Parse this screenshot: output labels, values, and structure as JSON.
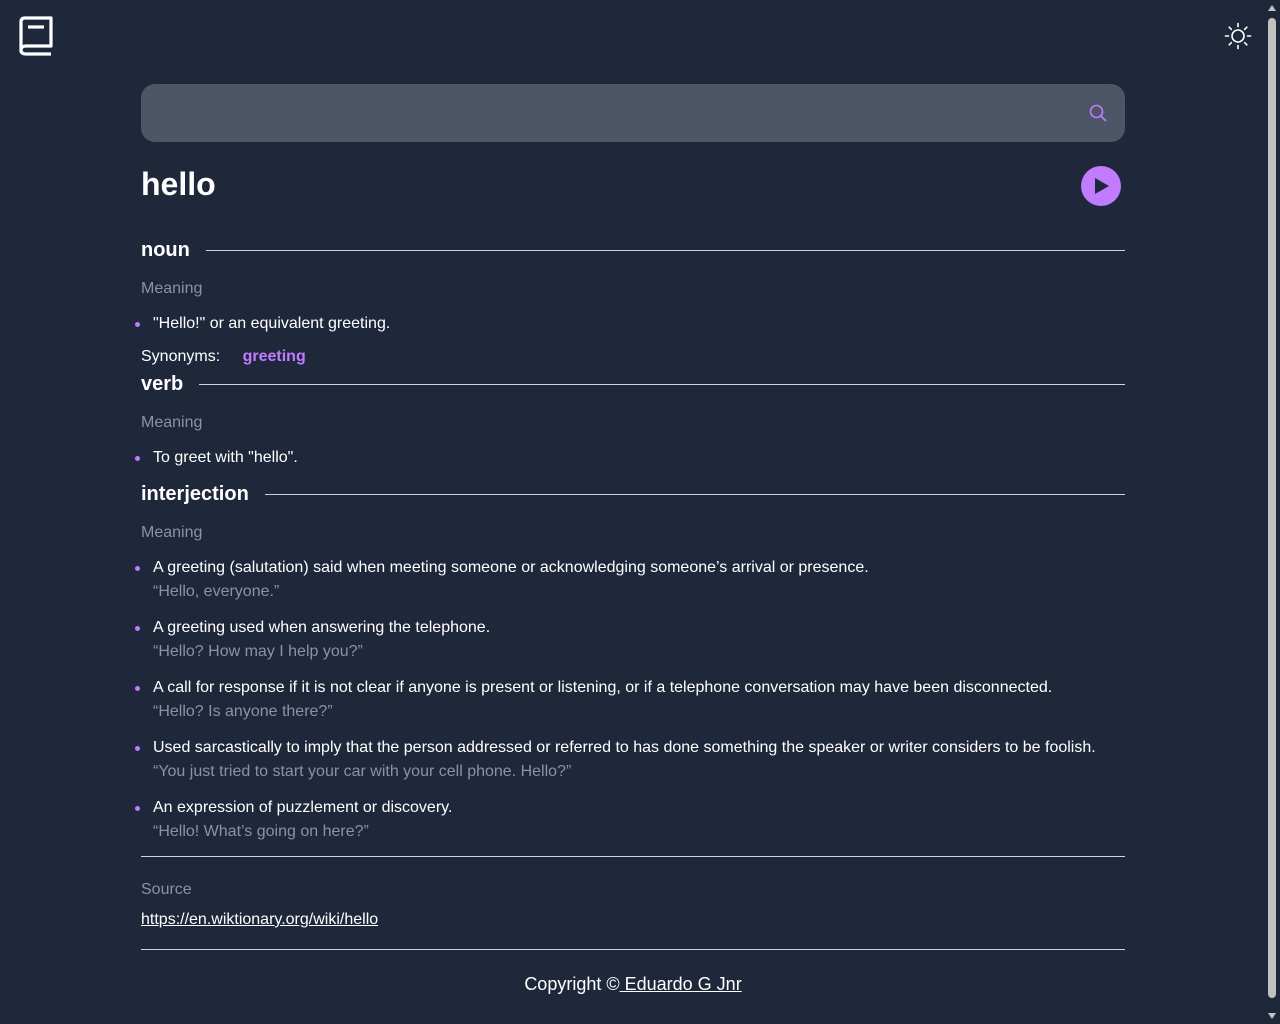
{
  "header": {
    "logo_icon": "book-icon",
    "theme_icon": "sun-icon"
  },
  "search": {
    "value": "",
    "placeholder": "",
    "icon": "search-icon"
  },
  "entry": {
    "word": "hello",
    "play_icon": "play-icon",
    "accent_color": "#c07bff"
  },
  "meanings": [
    {
      "part_of_speech": "noun",
      "label": "Meaning",
      "definitions": [
        {
          "text": "\"Hello!\" or an equivalent greeting."
        }
      ],
      "synonyms_label": "Synonyms:",
      "synonym": "greeting"
    },
    {
      "part_of_speech": "verb",
      "label": "Meaning",
      "definitions": [
        {
          "text": "To greet with \"hello\"."
        }
      ]
    },
    {
      "part_of_speech": "interjection",
      "label": "Meaning",
      "definitions": [
        {
          "text": "A greeting (salutation) said when meeting someone or acknowledging someone’s arrival or presence.",
          "example": "“Hello, everyone.”"
        },
        {
          "text": "A greeting used when answering the telephone.",
          "example": "“Hello? How may I help you?”"
        },
        {
          "text": "A call for response if it is not clear if anyone is present or listening, or if a telephone conversation may have been disconnected.",
          "example": "“Hello? Is anyone there?”"
        },
        {
          "text": "Used sarcastically to imply that the person addressed or referred to has done something the speaker or writer considers to be foolish.",
          "example": "“You just tried to start your car with your cell phone. Hello?”"
        },
        {
          "text": "An expression of puzzlement or discovery.",
          "example": "“Hello! What’s going on here?”"
        }
      ]
    }
  ],
  "source": {
    "label": "Source",
    "url": "https://en.wiktionary.org/wiki/hello"
  },
  "footer": {
    "prefix": "Copyright ©",
    "author": " Eduardo G Jnr"
  }
}
